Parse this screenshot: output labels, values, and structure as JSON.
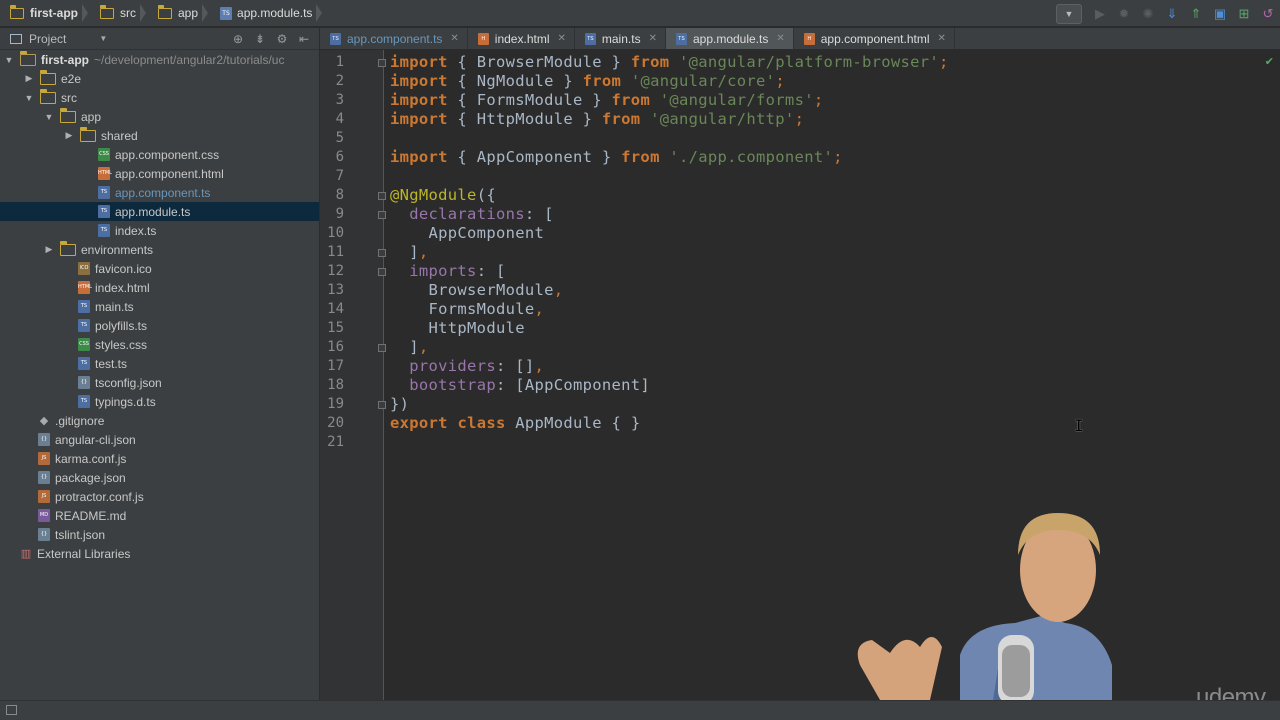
{
  "breadcrumb": [
    "first-app",
    "src",
    "app",
    "app.module.ts"
  ],
  "project_panel": {
    "title": "Project",
    "tree": [
      {
        "label": "first-app",
        "path": "~/development/angular2/tutorials/uc",
        "type": "root-folder",
        "depth": 0,
        "expanded": true
      },
      {
        "label": "e2e",
        "type": "folder",
        "depth": 1,
        "expanded": false
      },
      {
        "label": "src",
        "type": "folder",
        "depth": 1,
        "expanded": true
      },
      {
        "label": "app",
        "type": "folder",
        "depth": 2,
        "expanded": true
      },
      {
        "label": "shared",
        "type": "folder",
        "depth": 3,
        "expanded": false
      },
      {
        "label": "app.component.css",
        "type": "css",
        "depth": 4
      },
      {
        "label": "app.component.html",
        "type": "html",
        "depth": 4
      },
      {
        "label": "app.component.ts",
        "type": "ts",
        "depth": 4,
        "modified": true
      },
      {
        "label": "app.module.ts",
        "type": "ts",
        "depth": 4,
        "selected": true
      },
      {
        "label": "index.ts",
        "type": "ts",
        "depth": 4
      },
      {
        "label": "environments",
        "type": "folder",
        "depth": 2,
        "expanded": false
      },
      {
        "label": "favicon.ico",
        "type": "ico",
        "depth": 3
      },
      {
        "label": "index.html",
        "type": "html",
        "depth": 3
      },
      {
        "label": "main.ts",
        "type": "ts",
        "depth": 3
      },
      {
        "label": "polyfills.ts",
        "type": "ts",
        "depth": 3
      },
      {
        "label": "styles.css",
        "type": "css",
        "depth": 3
      },
      {
        "label": "test.ts",
        "type": "ts",
        "depth": 3
      },
      {
        "label": "tsconfig.json",
        "type": "json",
        "depth": 3
      },
      {
        "label": "typings.d.ts",
        "type": "ts",
        "depth": 3
      },
      {
        "label": ".gitignore",
        "type": "git",
        "depth": 1
      },
      {
        "label": "angular-cli.json",
        "type": "json",
        "depth": 1
      },
      {
        "label": "karma.conf.js",
        "type": "js",
        "depth": 1
      },
      {
        "label": "package.json",
        "type": "json",
        "depth": 1
      },
      {
        "label": "protractor.conf.js",
        "type": "js",
        "depth": 1
      },
      {
        "label": "README.md",
        "type": "md",
        "depth": 1
      },
      {
        "label": "tslint.json",
        "type": "json",
        "depth": 1
      },
      {
        "label": "External Libraries",
        "type": "lib",
        "depth": 0
      }
    ]
  },
  "tabs": [
    {
      "label": "app.component.ts",
      "type": "ts",
      "modified": true
    },
    {
      "label": "index.html",
      "type": "html"
    },
    {
      "label": "main.ts",
      "type": "ts"
    },
    {
      "label": "app.module.ts",
      "type": "ts",
      "active": true
    },
    {
      "label": "app.component.html",
      "type": "html"
    }
  ],
  "editor": {
    "lines": [
      [
        [
          "kw",
          "import"
        ],
        [
          "t",
          " { BrowserModule } "
        ],
        [
          "kw",
          "from"
        ],
        [
          "t",
          " "
        ],
        [
          "str",
          "'@angular/platform-browser'"
        ],
        [
          "punc",
          ";"
        ]
      ],
      [
        [
          "kw",
          "import"
        ],
        [
          "t",
          " { NgModule } "
        ],
        [
          "kw",
          "from"
        ],
        [
          "t",
          " "
        ],
        [
          "str",
          "'@angular/core'"
        ],
        [
          "punc",
          ";"
        ]
      ],
      [
        [
          "kw",
          "import"
        ],
        [
          "t",
          " { FormsModule } "
        ],
        [
          "kw",
          "from"
        ],
        [
          "t",
          " "
        ],
        [
          "str",
          "'@angular/forms'"
        ],
        [
          "punc",
          ";"
        ]
      ],
      [
        [
          "kw",
          "import"
        ],
        [
          "t",
          " { HttpModule } "
        ],
        [
          "kw",
          "from"
        ],
        [
          "t",
          " "
        ],
        [
          "str",
          "'@angular/http'"
        ],
        [
          "punc",
          ";"
        ]
      ],
      [],
      [
        [
          "kw",
          "import"
        ],
        [
          "t",
          " { AppComponent } "
        ],
        [
          "kw",
          "from"
        ],
        [
          "t",
          " "
        ],
        [
          "str",
          "'./app.component'"
        ],
        [
          "punc",
          ";"
        ]
      ],
      [],
      [
        [
          "ann",
          "@NgModule"
        ],
        [
          "t",
          "({"
        ]
      ],
      [
        [
          "t",
          "  "
        ],
        [
          "prop",
          "declarations"
        ],
        [
          "t",
          ": ["
        ]
      ],
      [
        [
          "t",
          "    AppComponent"
        ]
      ],
      [
        [
          "t",
          "  ]"
        ],
        [
          "punc",
          ","
        ]
      ],
      [
        [
          "t",
          "  "
        ],
        [
          "prop",
          "imports"
        ],
        [
          "t",
          ": ["
        ]
      ],
      [
        [
          "t",
          "    BrowserModule"
        ],
        [
          "punc",
          ","
        ]
      ],
      [
        [
          "t",
          "    FormsModule"
        ],
        [
          "punc",
          ","
        ]
      ],
      [
        [
          "t",
          "    HttpModule"
        ]
      ],
      [
        [
          "t",
          "  ]"
        ],
        [
          "punc",
          ","
        ]
      ],
      [
        [
          "t",
          "  "
        ],
        [
          "prop",
          "providers"
        ],
        [
          "t",
          ": []"
        ],
        [
          "punc",
          ","
        ]
      ],
      [
        [
          "t",
          "  "
        ],
        [
          "prop",
          "bootstrap"
        ],
        [
          "t",
          ": [AppComponent]"
        ]
      ],
      [
        [
          "t",
          "})"
        ]
      ],
      [
        [
          "kw",
          "export"
        ],
        [
          "t",
          " "
        ],
        [
          "kw",
          "class"
        ],
        [
          "t",
          " AppModule { }"
        ]
      ],
      []
    ],
    "fold_lines": [
      1,
      8,
      9,
      11,
      12,
      16,
      19
    ]
  },
  "watermark": "udemy",
  "colors": {
    "keyword": "#cc7832",
    "string": "#6a8759",
    "property": "#9876aa",
    "annotation": "#bbb529",
    "selection": "#0d293e"
  }
}
